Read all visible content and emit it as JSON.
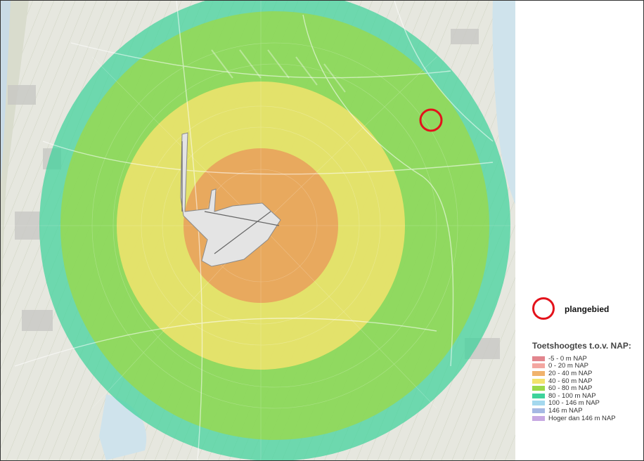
{
  "plan_marker": {
    "label": "plangebied",
    "color": "#e3121b"
  },
  "legend": {
    "title": "Toetshoogtes t.o.v. NAP:",
    "items": [
      {
        "label": "-5 - 0 m NAP",
        "color": "#e2868e"
      },
      {
        "label": "0 - 20 m NAP",
        "color": "#f3a7a1"
      },
      {
        "label": "20 - 40 m NAP",
        "color": "#f0b36d"
      },
      {
        "label": "40 - 60 m NAP",
        "color": "#f2e36d"
      },
      {
        "label": "60 - 80 m NAP",
        "color": "#9ad94a"
      },
      {
        "label": "80 - 100 m NAP",
        "color": "#3ed39b"
      },
      {
        "label": "100 - 146 m NAP",
        "color": "#a4d8ee"
      },
      {
        "label": "146 m NAP",
        "color": "#a5b8e3"
      },
      {
        "label": "Hoger dan 146 m NAP",
        "color": "#c7a8e2"
      }
    ]
  }
}
